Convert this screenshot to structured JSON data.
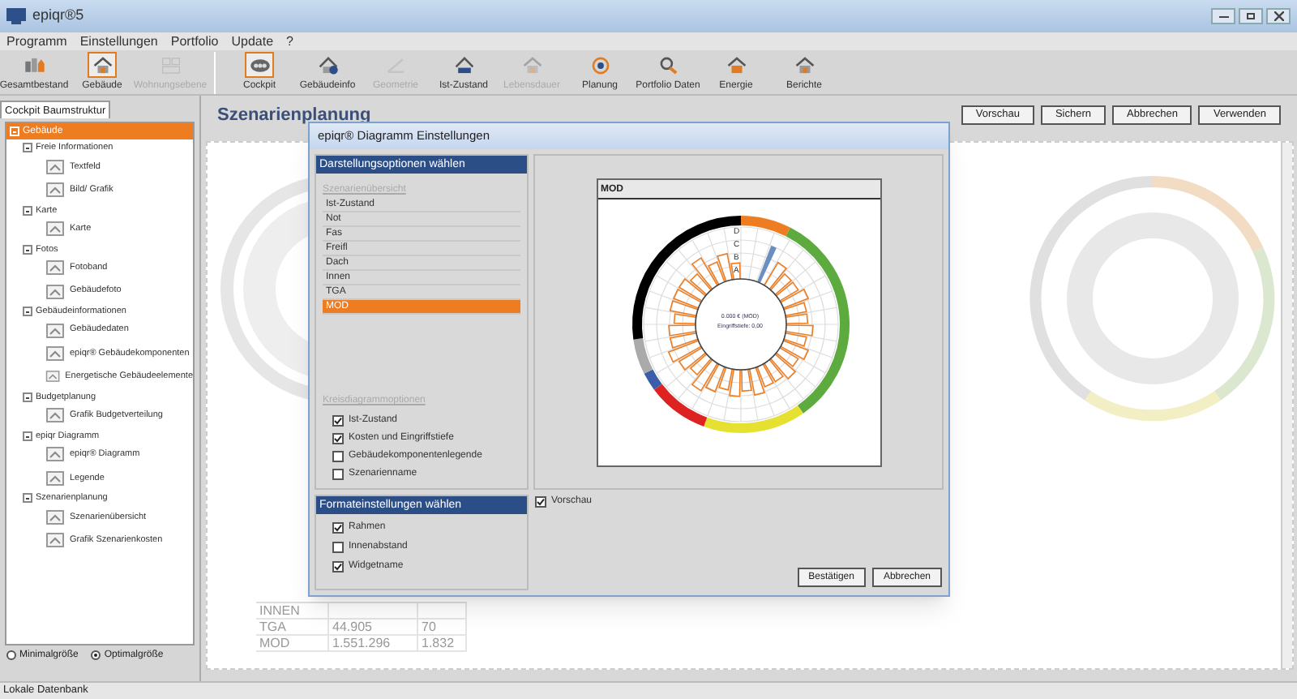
{
  "window": {
    "title": "epiqr®5"
  },
  "menu": [
    "Programm",
    "Einstellungen",
    "Portfolio",
    "Update",
    "?"
  ],
  "toolbar": [
    {
      "label": "Gesamtbestand",
      "selected": false,
      "disabled": false,
      "kind": "buildings"
    },
    {
      "label": "Gebäude",
      "selected": true,
      "disabled": false,
      "kind": "house"
    },
    {
      "label": "Wohnungsebene",
      "selected": false,
      "disabled": true,
      "kind": "plan"
    },
    {
      "label": "Cockpit",
      "selected": true,
      "disabled": false,
      "kind": "cockpit"
    },
    {
      "label": "Gebäudeinfo",
      "selected": false,
      "disabled": false,
      "kind": "info"
    },
    {
      "label": "Geometrie",
      "selected": false,
      "disabled": true,
      "kind": "geometry"
    },
    {
      "label": "Ist-Zustand",
      "selected": false,
      "disabled": false,
      "kind": "state"
    },
    {
      "label": "Lebensdauer",
      "selected": false,
      "disabled": true,
      "kind": "house"
    },
    {
      "label": "Planung",
      "selected": false,
      "disabled": false,
      "kind": "planning"
    },
    {
      "label": "Portfolio Daten",
      "selected": false,
      "disabled": false,
      "kind": "search"
    },
    {
      "label": "Energie",
      "selected": false,
      "disabled": false,
      "kind": "energy"
    },
    {
      "label": "Berichte",
      "selected": false,
      "disabled": false,
      "kind": "house"
    }
  ],
  "sidebar": {
    "tab": "Cockpit Baumstruktur",
    "tree": [
      {
        "label": "Gebäude",
        "selected": true,
        "expanded": true,
        "children": [
          {
            "label": "Freie Informationen",
            "expanded": true,
            "children": [
              {
                "label": "Textfeld"
              },
              {
                "label": "Bild/ Grafik"
              }
            ]
          },
          {
            "label": "Karte",
            "expanded": true,
            "children": [
              {
                "label": "Karte"
              }
            ]
          },
          {
            "label": "Fotos",
            "expanded": true,
            "children": [
              {
                "label": "Fotoband"
              },
              {
                "label": "Gebäudefoto"
              }
            ]
          },
          {
            "label": "Gebäudeinformationen",
            "expanded": true,
            "children": [
              {
                "label": "Gebäudedaten"
              },
              {
                "label": "epiqr® Gebäudekomponenten"
              },
              {
                "label": "Energetische Gebäudeelemente"
              }
            ]
          },
          {
            "label": "Budgetplanung",
            "expanded": true,
            "children": [
              {
                "label": "Grafik Budgetverteilung"
              }
            ]
          },
          {
            "label": "epiqr Diagramm",
            "expanded": true,
            "children": [
              {
                "label": "epiqr® Diagramm"
              },
              {
                "label": "Legende"
              }
            ]
          },
          {
            "label": "Szenarienplanung",
            "expanded": true,
            "children": [
              {
                "label": "Szenarienübersicht"
              },
              {
                "label": "Grafik Szenarienkosten"
              }
            ]
          }
        ]
      }
    ],
    "size_options": [
      {
        "label": "Minimalgröße",
        "selected": false
      },
      {
        "label": "Optimalgröße",
        "selected": true
      }
    ]
  },
  "main": {
    "title": "Szenarienplanung",
    "buttons": [
      "Vorschau",
      "Sichern",
      "Abbrechen",
      "Verwenden"
    ],
    "background_table": [
      [
        "INNEN"
      ],
      [
        "TGA",
        "44.905",
        "70"
      ],
      [
        "MOD",
        "1.551.296",
        "1.832"
      ]
    ]
  },
  "dialog": {
    "title": "epiqr® Diagramm Einstellungen",
    "display_section": "Darstellungsoptionen wählen",
    "list_header": "Szenarienübersicht",
    "list": [
      {
        "label": "Ist-Zustand",
        "selected": false
      },
      {
        "label": "Not",
        "selected": false
      },
      {
        "label": "Fas",
        "selected": false
      },
      {
        "label": "Freifl",
        "selected": false
      },
      {
        "label": "Dach",
        "selected": false
      },
      {
        "label": "Innen",
        "selected": false
      },
      {
        "label": "TGA",
        "selected": false
      },
      {
        "label": "MOD",
        "selected": true
      }
    ],
    "pie_header": "Kreisdiagrammoptionen",
    "pie_options": [
      {
        "label": "Ist-Zustand",
        "checked": true
      },
      {
        "label": "Kosten und Eingriffstiefe",
        "checked": true
      },
      {
        "label": "Gebäudekomponentenlegende",
        "checked": false
      },
      {
        "label": "Szenarienname",
        "checked": false
      }
    ],
    "format_section": "Formateinstellungen wählen",
    "format_options": [
      {
        "label": "Rahmen",
        "checked": true
      },
      {
        "label": "Innenabstand",
        "checked": false
      },
      {
        "label": "Widgetname",
        "checked": true
      }
    ],
    "preview": {
      "title": "MOD",
      "ring_labels": [
        "D",
        "C",
        "B",
        "A"
      ],
      "center_lines": [
        "0.000 € (MOD)",
        "Eingriffstiefe: 0,00"
      ]
    },
    "preview_option": {
      "label": "Vorschau",
      "checked": true
    },
    "buttons": [
      "Bestätigen",
      "Abbrechen"
    ]
  },
  "status_bar": "Lokale Datenbank"
}
